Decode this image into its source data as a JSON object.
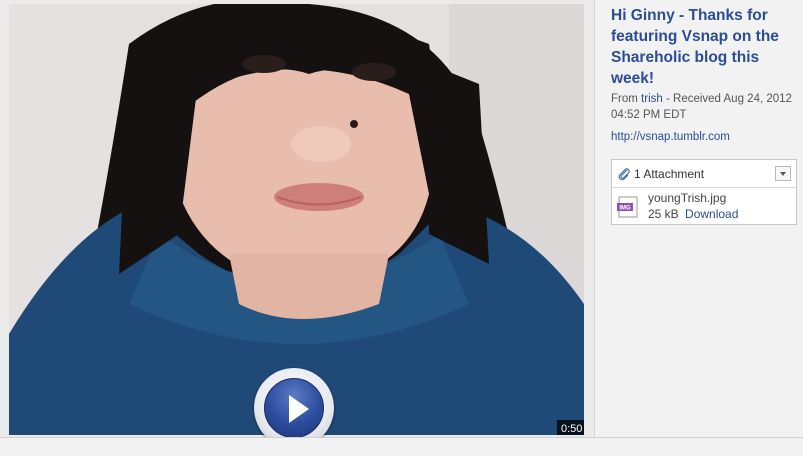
{
  "message": {
    "title": "Hi Ginny - Thanks for featuring Vsnap on the Shareholic blog this week!",
    "from_prefix": "From",
    "sender": "trish",
    "received": "- Received Aug 24, 2012 04:52 PM EDT",
    "link": "http://vsnap.tumblr.com"
  },
  "attachments": {
    "header": "1 Attachment",
    "items": [
      {
        "filename": "youngTrish.jpg",
        "size": "25 kB",
        "download_label": "Download",
        "type_badge": "IMG"
      }
    ]
  },
  "video": {
    "duration": "0:50",
    "thumbnail": "portrait-thumbnail",
    "play_icon": "play-icon"
  },
  "colors": {
    "link": "#2b4d95",
    "play_button": "#2c4c9c",
    "background": "#f2f2f2"
  }
}
